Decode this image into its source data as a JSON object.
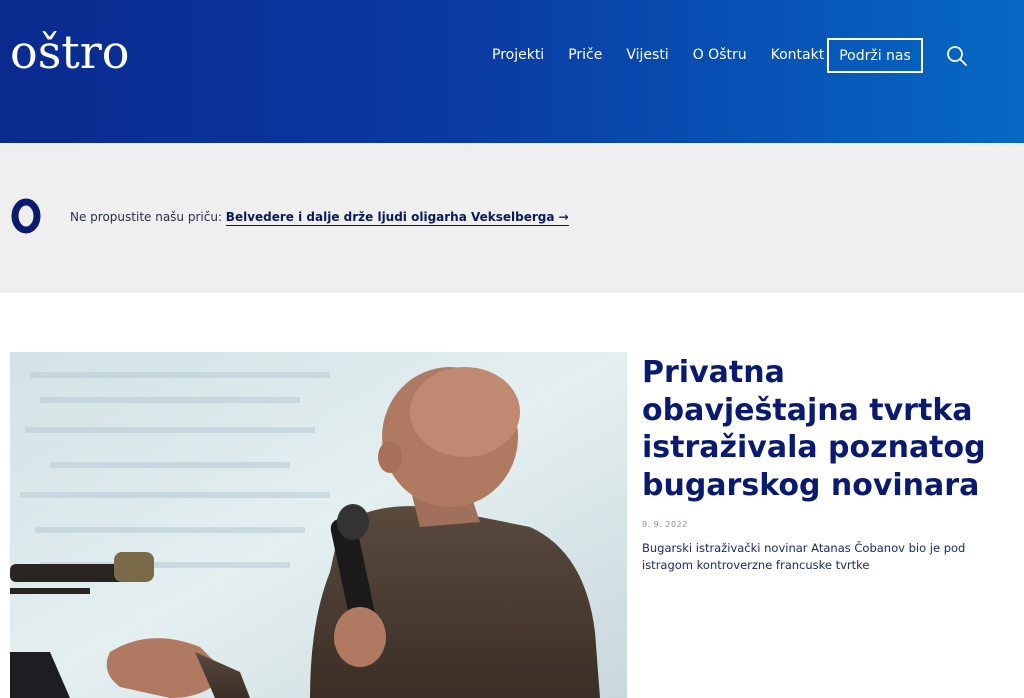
{
  "header": {
    "logo": "oštro",
    "nav": [
      "Projekti",
      "Priče",
      "Vijesti",
      "O Oštru",
      "Kontakt"
    ],
    "support_label": "Podrži nas",
    "search_icon": "search-icon"
  },
  "banner": {
    "lead": "Ne propustite našu priču: ",
    "link": "Belvedere i dalje drže ljudi oligarha Vekselberga →"
  },
  "article": {
    "title": "Privatna obavještajna tvrtka istraživala poznatog bugarskog novinara",
    "date": "9. 9. 2022",
    "excerpt": "Bugarski istraživački novinar Atanas Čobanov bio je pod istragom kontroverzne francuske tvrtke"
  },
  "colors": {
    "header_start": "#0a2a8e",
    "header_end": "#0668c4",
    "banner_bg": "#efefef",
    "title": "#0a1a6e"
  }
}
